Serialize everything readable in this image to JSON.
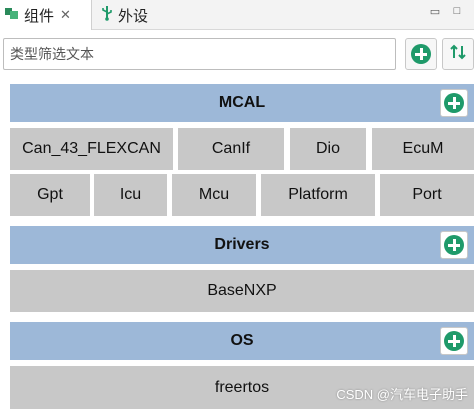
{
  "tabs": [
    {
      "label": "组件",
      "close": "✕"
    },
    {
      "label": "外设"
    }
  ],
  "filter": {
    "value": "类型筛选文本"
  },
  "toolbar": {
    "add_icon": "plus-circle-icon",
    "sort_icon": "sort-arrows-icon"
  },
  "groups": {
    "mcal": {
      "title": "MCAL",
      "items": [
        "Can_43_FLEXCAN",
        "CanIf",
        "Dio",
        "EcuM",
        "Gpt",
        "Icu",
        "Mcu",
        "Platform",
        "Port"
      ]
    },
    "drivers": {
      "title": "Drivers",
      "items": [
        "BaseNXP"
      ]
    },
    "os": {
      "title": "OS",
      "items": [
        "freertos"
      ]
    }
  },
  "watermark": "CSDN @汽车电子助手",
  "colors": {
    "header": "#9db8d8",
    "chip": "#c8c8c8",
    "accent_green": "#1f9a6a"
  }
}
